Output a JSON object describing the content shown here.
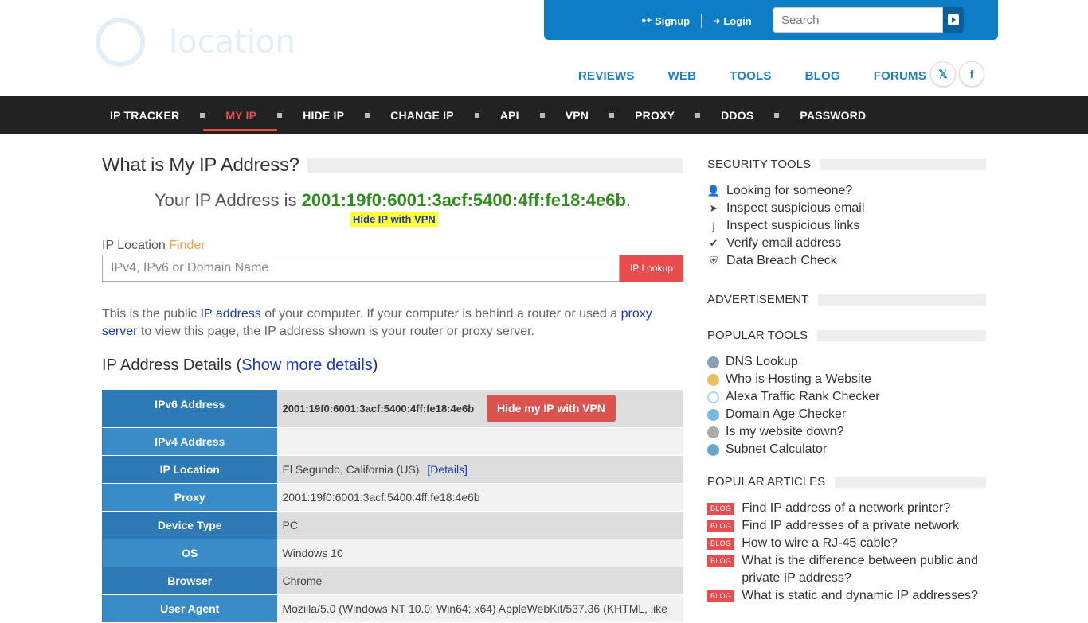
{
  "header": {
    "logo_text": "location",
    "signup": "Signup",
    "login": "Login",
    "search_placeholder": "Search",
    "subnav": [
      "REVIEWS",
      "WEB",
      "TOOLS",
      "BLOG",
      "FORUMS"
    ],
    "social": [
      "twitter",
      "facebook"
    ]
  },
  "mainnav": [
    "IP TRACKER",
    "MY IP",
    "HIDE IP",
    "CHANGE IP",
    "API",
    "VPN",
    "PROXY",
    "DDOS",
    "PASSWORD"
  ],
  "mainnav_active": "MY IP",
  "content": {
    "title": "What is My IP Address?",
    "yourip_prefix": "Your IP Address is ",
    "ip": "2001:19f0:6001:3acf:5400:4ff:fe18:4e6b",
    "yourip_suffix": ".",
    "hide_vpn": "Hide IP with VPN",
    "finder_label_1": "IP Location ",
    "finder_label_2": "Finder",
    "finder_placeholder": "IPv4, IPv6 or Domain Name",
    "lookup_button": "IP Lookup",
    "desc_1": "This is the public ",
    "desc_link1": "IP address",
    "desc_2": " of your computer. If your computer is behind a router or used a ",
    "desc_link2": "proxy server",
    "desc_3": " to view this page, the IP address shown is your router or proxy server.",
    "details_title": "IP Address Details (",
    "details_link": "Show more details",
    "details_close": ")",
    "table": {
      "ipv6_label": "IPv6 Address",
      "ipv6_value": "2001:19f0:6001:3acf:5400:4ff:fe18:4e6b",
      "vpn_button": "Hide my IP with VPN",
      "ipv4_label": "IPv4 Address",
      "ipv4_value": "",
      "location_label": "IP Location",
      "location_value": "El Segundo, California (US)",
      "location_link": "[Details]",
      "proxy_label": "Proxy",
      "proxy_value": "2001:19f0:6001:3acf:5400:4ff:fe18:4e6b",
      "device_label": "Device Type",
      "device_value": "PC",
      "os_label": "OS",
      "os_value": "Windows 10",
      "browser_label": "Browser",
      "browser_value": "Chrome",
      "ua_label": "User Agent",
      "ua_value": "Mozilla/5.0 (Windows NT 10.0; Win64; x64) AppleWebKit/537.36 (KHTML, like"
    }
  },
  "sidebar": {
    "security_title": "SECURITY TOOLS",
    "security_items": [
      {
        "icon": "user-icon",
        "label": "Looking for someone?"
      },
      {
        "icon": "paper-plane-icon",
        "label": "Inspect suspicious email"
      },
      {
        "icon": "hook-icon",
        "label": "Inspect suspicious links"
      },
      {
        "icon": "check-icon",
        "label": "Verify email address"
      },
      {
        "icon": "shield-icon",
        "label": "Data Breach Check"
      }
    ],
    "ad_title": "ADVERTISEMENT",
    "popular_title": "POPULAR TOOLS",
    "popular_items": [
      {
        "icon": "globe-icon",
        "label": "DNS Lookup",
        "color": "#8aa0b8"
      },
      {
        "icon": "server-icon",
        "label": "Who is Hosting a Website",
        "color": "#e8c060"
      },
      {
        "icon": "ring-icon",
        "label": "Alexa Traffic Rank Checker",
        "color": "#a8d8f0"
      },
      {
        "icon": "cloud-icon",
        "label": "Domain Age Checker",
        "color": "#7ab8e0"
      },
      {
        "icon": "status-icon",
        "label": "Is my website down?",
        "color": "#aaaaaa"
      },
      {
        "icon": "subnet-icon",
        "label": "Subnet Calculator",
        "color": "#6aa8c8"
      }
    ],
    "articles_title": "POPULAR ARTICLES",
    "blog_tag": "BLOG",
    "articles": [
      "Find IP address of a network printer?",
      "Find IP addresses of a private network",
      "How to wire a RJ-45 cable?",
      "What is the difference between public and  private IP address?",
      "What is static and dynamic IP addresses?"
    ]
  }
}
